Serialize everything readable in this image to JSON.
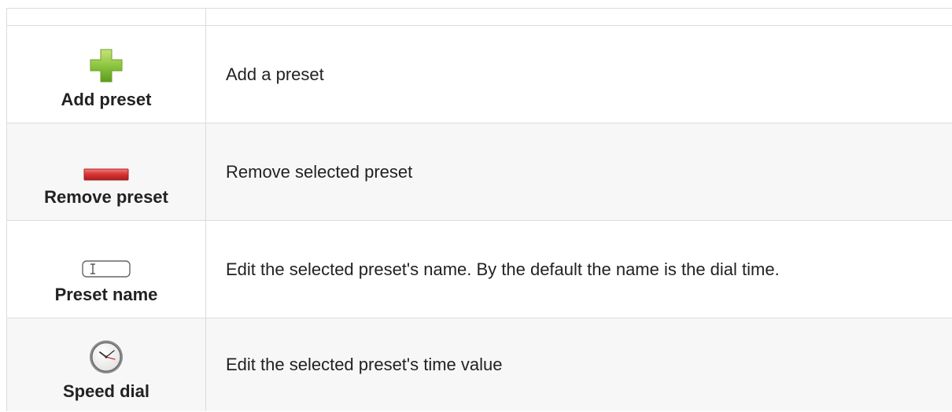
{
  "rows": [
    {
      "label": "Add preset",
      "description": "Add a preset",
      "icon": "plus-icon"
    },
    {
      "label": "Remove preset",
      "description": "Remove selected preset",
      "icon": "minus-icon"
    },
    {
      "label": "Preset name",
      "description": "Edit the selected preset's name. By the default the name is the dial time.",
      "icon": "text-field-icon"
    },
    {
      "label": "Speed dial",
      "description": "Edit the selected preset's time value",
      "icon": "clock-icon"
    }
  ],
  "colors": {
    "plus_green": "#8cc63f",
    "minus_red": "#d93636",
    "alt_row_bg": "#f7f7f7",
    "border": "#dcdcdc"
  }
}
